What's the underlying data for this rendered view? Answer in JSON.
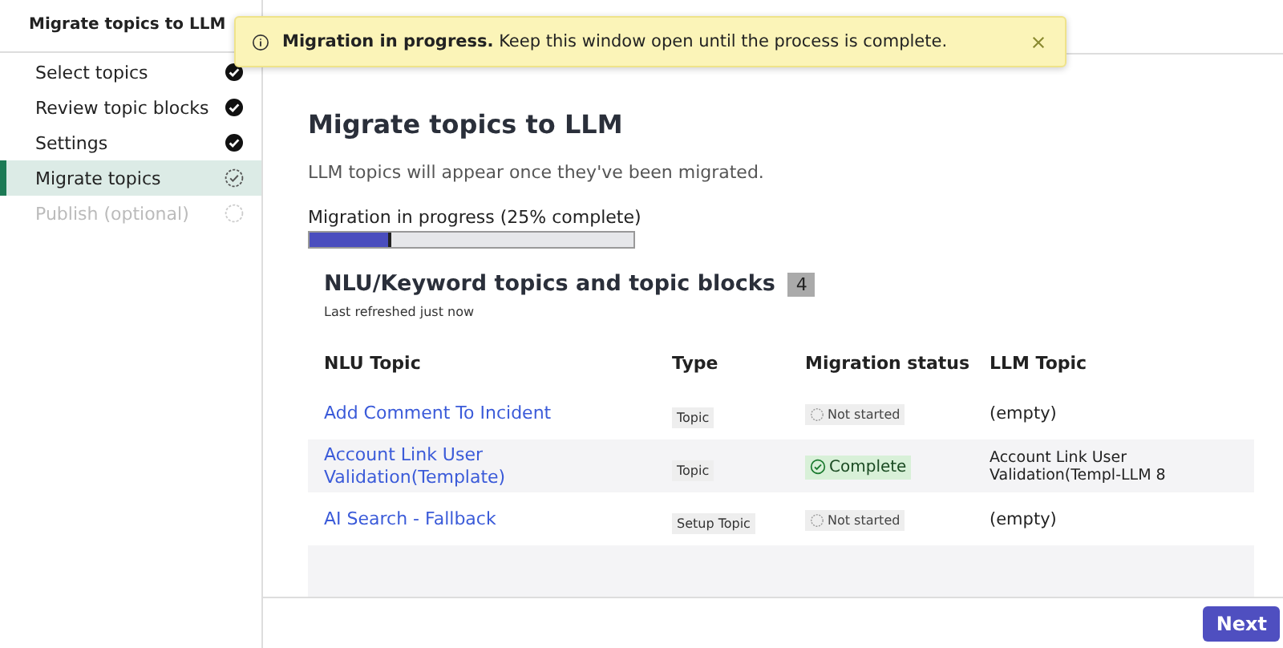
{
  "sidebar": {
    "title": "Migrate topics to LLM",
    "steps": [
      {
        "label": "Select topics",
        "kind": "done",
        "selected": false
      },
      {
        "label": "Review topic blocks",
        "kind": "done",
        "selected": false
      },
      {
        "label": "Settings",
        "kind": "done",
        "selected": false
      },
      {
        "label": "Migrate topics",
        "kind": "current",
        "selected": true
      },
      {
        "label": "Publish (optional)",
        "kind": "pending",
        "selected": false
      }
    ]
  },
  "toast": {
    "bold": "Migration in progress.",
    "message": "Keep this window open until the process is complete."
  },
  "main": {
    "heading": "Migrate topics to LLM",
    "description": "LLM topics will appear once they've been migrated.",
    "progress": {
      "label": "Migration in progress (25% complete)",
      "level": 0.25
    },
    "section": {
      "title": "NLU/Keyword topics and topic blocks",
      "count": "4",
      "subtitle": "Last refreshed just now"
    },
    "table": {
      "columns": [
        "NLU Topic",
        "Type",
        "Migration status",
        "LLM Topic"
      ],
      "rows": [
        {
          "topic": "Add Comment To Incident",
          "type": "Topic",
          "kind": "not_started",
          "status_label": "Not started",
          "llm": "(empty)"
        },
        {
          "topic": "Account Link User Validation(Template)",
          "type": "Topic",
          "kind": "complete",
          "status_label": "Complete",
          "llm": "Account Link User Validation(Templ-LLM 8"
        },
        {
          "topic": "AI Search - Fallback",
          "type": "Setup Topic",
          "kind": "not_started",
          "status_label": "Not started",
          "llm": "(empty)"
        }
      ]
    }
  },
  "footer": {
    "next": "Next"
  }
}
